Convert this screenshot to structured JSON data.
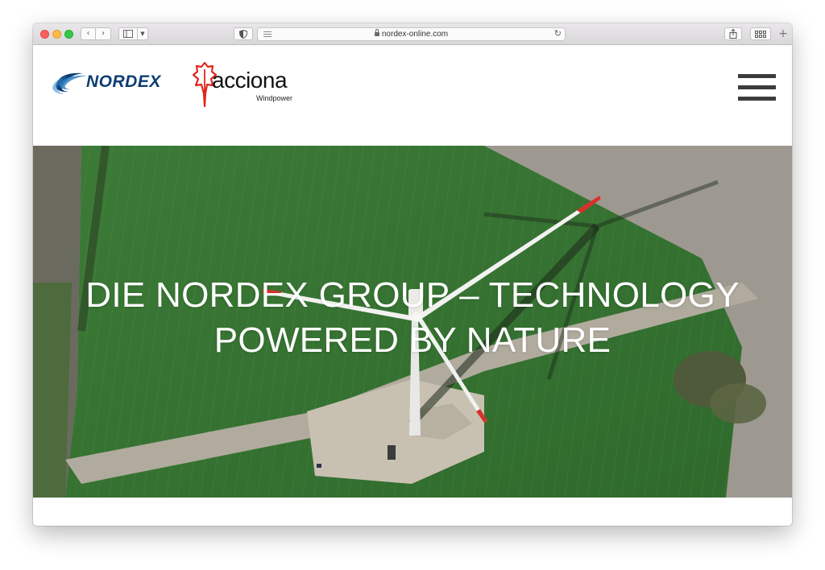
{
  "browser": {
    "url": "nordex-online.com",
    "icons": {
      "back": "chevron-left-icon",
      "forward": "chevron-right-icon",
      "sidebar": "sidebar-icon",
      "shield": "shield-icon",
      "reader": "reader-icon",
      "lock": "lock-icon",
      "reload": "reload-icon",
      "share": "share-icon",
      "tabs": "tabs-overview-icon",
      "new_tab": "plus-icon"
    }
  },
  "header": {
    "nordex_logo_text": "NORDEX",
    "acciona_logo_text": "acciona",
    "acciona_logo_sub": "Windpower",
    "menu_icon": "hamburger-menu-icon"
  },
  "hero": {
    "title_line1": "DIE NORDEX GROUP – TECHNOLOGY",
    "title_line2": "POWERED BY NATURE"
  },
  "colors": {
    "nordex_blue": "#0d3d73",
    "acciona_red": "#e1261c",
    "menu_gray": "#3c3c3c",
    "field_green": "#3f7a3a"
  }
}
